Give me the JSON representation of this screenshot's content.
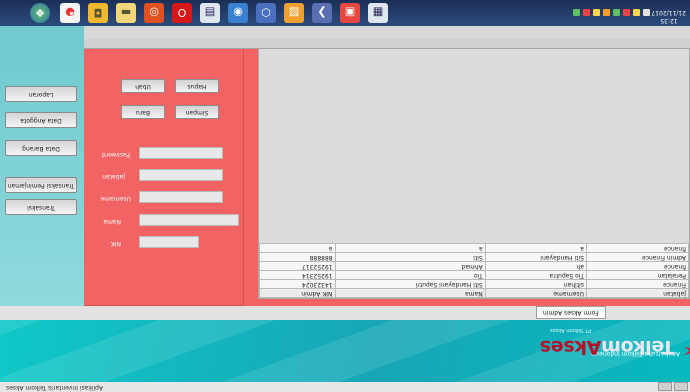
{
  "window": {
    "status_text": "Aplikasi Inventaris Telkom Akses"
  },
  "banner": {
    "brand_part1": "Telkom",
    "brand_part2": "Akses",
    "tagline": "PT Telkom Akses",
    "right_note": "Anak Usaha Telkom Indonesia"
  },
  "tabs": [
    {
      "label": "Form Akses Admin"
    }
  ],
  "nav": {
    "items": [
      {
        "label": "Laporan"
      },
      {
        "label": "Data Anggota"
      },
      {
        "label": "Data Barang"
      },
      {
        "label": "Transaksi Peminjaman"
      },
      {
        "label": "Transaksi"
      }
    ]
  },
  "form": {
    "fields": [
      {
        "label": "Password",
        "value": ""
      },
      {
        "label": "Jabatan",
        "value": ""
      },
      {
        "label": "Username",
        "value": ""
      },
      {
        "label": "Nama",
        "value": ""
      },
      {
        "label": "NIK",
        "value": ""
      }
    ],
    "buttons": {
      "save": "Baru",
      "cancel": "Simpan",
      "edit": "Ubah",
      "delete": "Hapus"
    }
  },
  "table": {
    "columns": [
      "NIK Admin",
      "Nama",
      "Username",
      "Jabatan"
    ],
    "rows": [
      [
        "14323024",
        "Siti Handayani Saputri",
        "sitihan",
        "Finance"
      ],
      [
        "19252314",
        "Tio",
        "Tio Saputra",
        "Peralatan"
      ],
      [
        "19252317",
        "Ahmad",
        "ah",
        "finance"
      ],
      [
        "888888",
        "Siti",
        "Siti Handayani",
        "Admin Finance"
      ],
      [
        "a",
        "a",
        "a",
        "finance"
      ]
    ]
  },
  "taskbar": {
    "clock_time": "12:35",
    "clock_date": "21/11/2017"
  }
}
